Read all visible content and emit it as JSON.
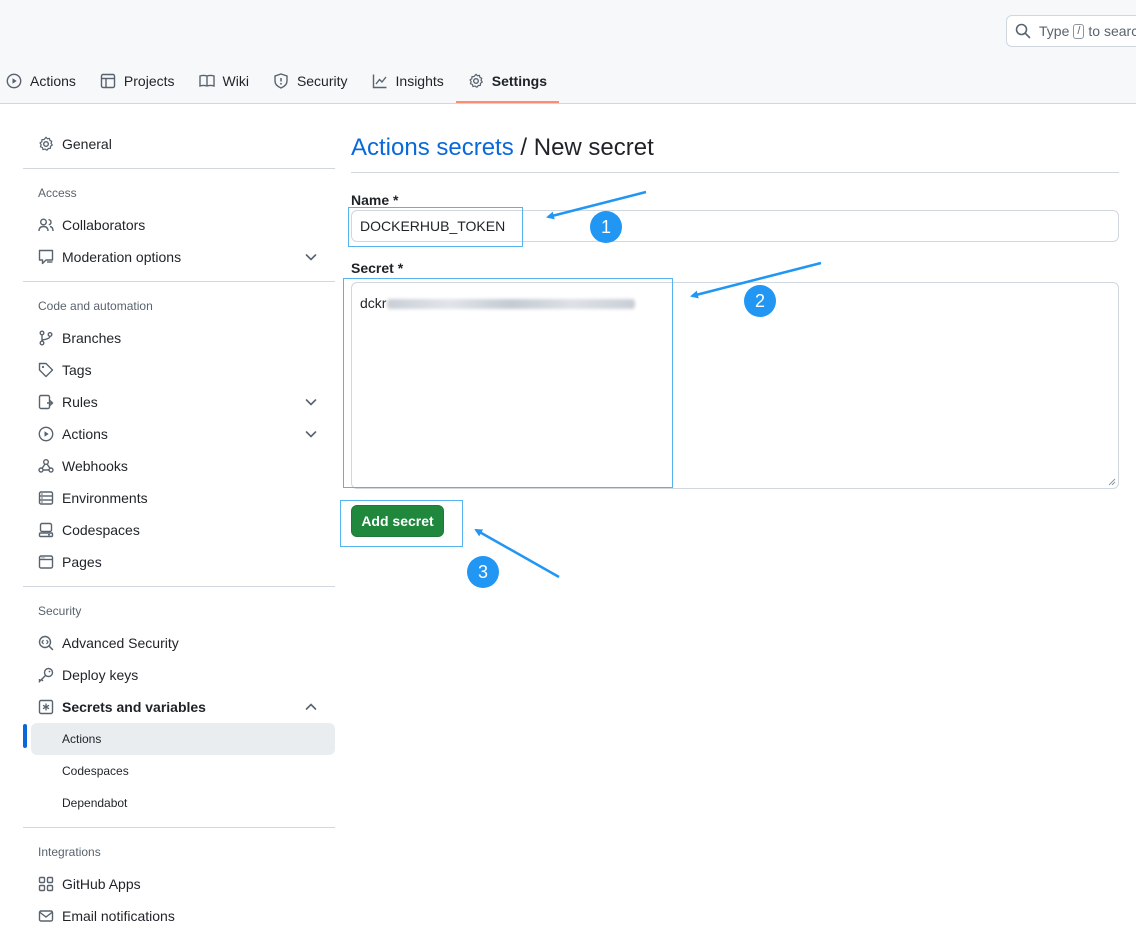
{
  "header": {
    "search_text": "Type",
    "search_key": "/",
    "search_text_after": "to search",
    "tabs": [
      {
        "label": "Actions",
        "icon": "play-icon"
      },
      {
        "label": "Projects",
        "icon": "table-icon"
      },
      {
        "label": "Wiki",
        "icon": "book-icon"
      },
      {
        "label": "Security",
        "icon": "shield-icon"
      },
      {
        "label": "Insights",
        "icon": "graph-icon"
      },
      {
        "label": "Settings",
        "icon": "gear-icon",
        "active": true
      }
    ]
  },
  "sidebar": {
    "general": "General",
    "access_title": "Access",
    "collaborators": "Collaborators",
    "moderation": "Moderation options",
    "code_title": "Code and automation",
    "branches": "Branches",
    "tags": "Tags",
    "rules": "Rules",
    "actions": "Actions",
    "webhooks": "Webhooks",
    "environments": "Environments",
    "codespaces": "Codespaces",
    "pages": "Pages",
    "security_title": "Security",
    "advanced_security": "Advanced Security",
    "deploy_keys": "Deploy keys",
    "secrets_variables": "Secrets and variables",
    "sub_actions": "Actions",
    "sub_codespaces": "Codespaces",
    "sub_dependabot": "Dependabot",
    "integrations_title": "Integrations",
    "github_apps": "GitHub Apps",
    "email_notifications": "Email notifications"
  },
  "main": {
    "breadcrumb_link": "Actions secrets",
    "breadcrumb_sep": " / ",
    "breadcrumb_current": "New secret",
    "name_label": "Name *",
    "name_value": "DOCKERHUB_TOKEN",
    "secret_label": "Secret *",
    "secret_value_visible": "dckr",
    "add_button": "Add secret"
  },
  "annotations": {
    "badge_1": "1",
    "badge_2": "2",
    "badge_3": "3",
    "color": "#2196f3"
  },
  "colors": {
    "accent": "#0969da",
    "button_green": "#1f883d",
    "tab_underline": "#fd8c73"
  }
}
